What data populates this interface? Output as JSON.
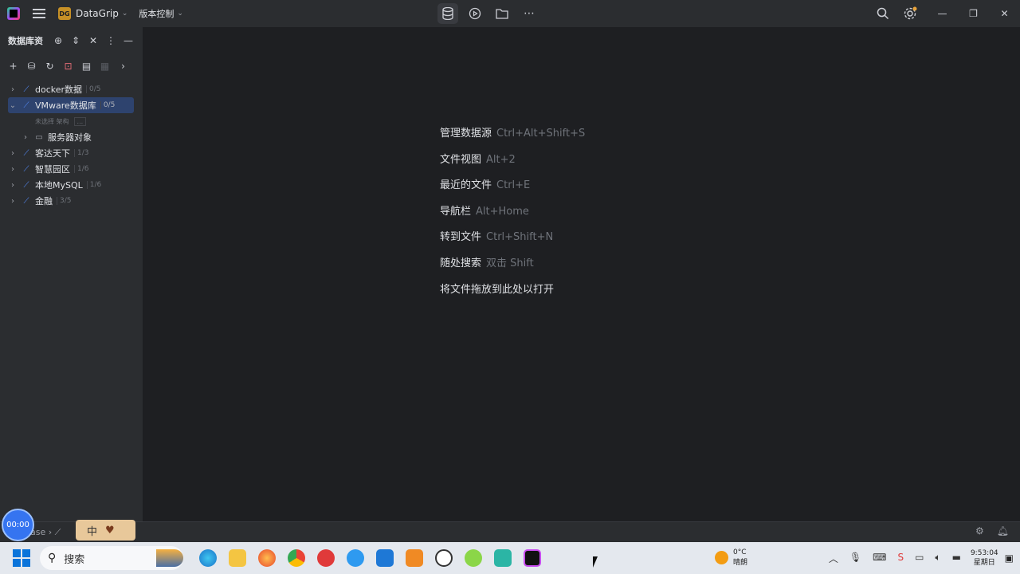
{
  "titlebar": {
    "project": "DataGrip",
    "project_badge": "DG",
    "vcs": "版本控制",
    "icons": [
      "database-icon",
      "run-icon",
      "folder-icon",
      "more-icon"
    ],
    "right_icons": [
      "search-icon",
      "settings-icon"
    ]
  },
  "panel": {
    "title": "数据库资",
    "tree": [
      {
        "label": "docker数据",
        "count": "0/5",
        "expanded": false
      },
      {
        "label": "VMware数据库",
        "count": "0/5",
        "expanded": true,
        "selected": true
      },
      {
        "label": "客达天下",
        "count": "1/3",
        "expanded": false
      },
      {
        "label": "智慧园区",
        "count": "1/6",
        "expanded": false
      },
      {
        "label": "本地MySQL",
        "count": "1/6",
        "expanded": false
      },
      {
        "label": "金融",
        "count": "3/5",
        "expanded": false
      }
    ],
    "sub_label": "未选择 架构",
    "sub_dots": "...",
    "server_objects": "服务器对象"
  },
  "hints": [
    {
      "label": "管理数据源",
      "shortcut": "Ctrl+Alt+Shift+S"
    },
    {
      "label": "文件视图",
      "shortcut": "Alt+2"
    },
    {
      "label": "最近的文件",
      "shortcut": "Ctrl+E"
    },
    {
      "label": "导航栏",
      "shortcut": "Alt+Home"
    },
    {
      "label": "转到文件",
      "shortcut": "Ctrl+Shift+N"
    },
    {
      "label": "随处搜索",
      "shortcut": "双击 Shift"
    },
    {
      "label": "将文件拖放到此处以打开",
      "shortcut": ""
    }
  ],
  "status": {
    "timer": "00:00",
    "crumb": "ase",
    "ime": "中"
  },
  "taskbar": {
    "search_placeholder": "搜索",
    "weather_temp": "0°C",
    "weather_desc": "晴朗",
    "time": "9:53:04",
    "day": "星期日"
  }
}
